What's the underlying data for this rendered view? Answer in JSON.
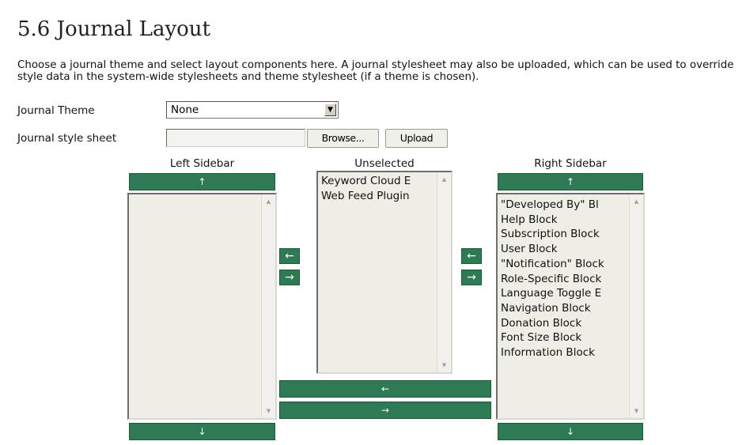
{
  "page": {
    "title": "5.6 Journal Layout",
    "description": "Choose a journal theme and select layout components here. A journal stylesheet may also be uploaded, which can be used to override style data in the system-wide stylesheets and theme stylesheet (if a theme is chosen)."
  },
  "form": {
    "theme_label": "Journal Theme",
    "theme_value": "None",
    "stylesheet_label": "Journal style sheet",
    "stylesheet_value": "",
    "browse_label": "Browse...",
    "upload_label": "Upload"
  },
  "columns": {
    "left": {
      "title": "Left Sidebar",
      "items": []
    },
    "unselected": {
      "title": "Unselected",
      "items": [
        "Keyword Cloud E",
        "Web Feed Plugin"
      ]
    },
    "right": {
      "title": "Right Sidebar",
      "items": [
        "\"Developed By\" Bl",
        "Help Block",
        "Subscription Block",
        "User Block",
        "\"Notification\" Block",
        "Role-Specific Block",
        "Language Toggle E",
        "Navigation Block",
        "Donation Block",
        "Font Size Block",
        "Information Block"
      ]
    }
  },
  "arrows": {
    "up": "↑",
    "down": "↓",
    "left": "←",
    "right": "→",
    "scroll_up": "▲",
    "scroll_down": "▼",
    "dropdown": "▼"
  },
  "colors": {
    "button_green": "#2e7a54",
    "listbox_bg": "#efeee6"
  }
}
